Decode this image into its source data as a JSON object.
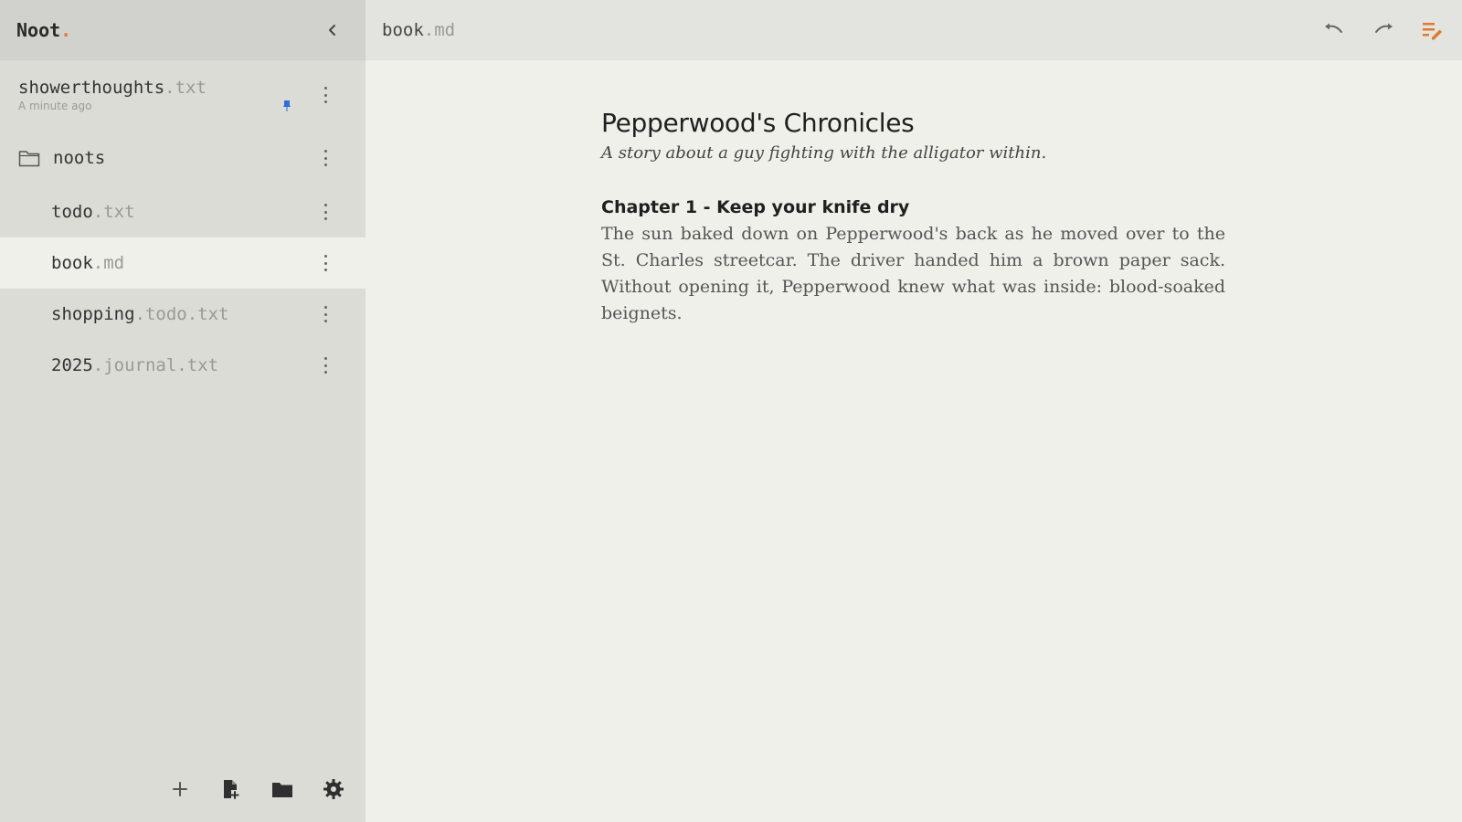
{
  "app": {
    "brand": "Noot",
    "brand_dot": "."
  },
  "sidebar": {
    "pinned": {
      "name": "showerthoughts",
      "ext": ".txt",
      "subtitle": "A minute ago"
    },
    "folder": {
      "name": "noots"
    },
    "files": [
      {
        "name": "todo",
        "ext": ".txt",
        "selected": false
      },
      {
        "name": "book",
        "ext": ".md",
        "selected": true
      },
      {
        "name": "shopping",
        "ext": ".todo.txt",
        "selected": false
      },
      {
        "name": "2025",
        "ext": ".journal.txt",
        "selected": false
      }
    ],
    "footer_icons": [
      "plus-icon",
      "new-file-icon",
      "folder-icon",
      "gear-icon"
    ]
  },
  "topbar": {
    "title_name": "book",
    "title_ext": ".md",
    "icons": [
      "undo-icon",
      "redo-icon",
      "edit-mode-icon"
    ]
  },
  "document": {
    "title": "Pepperwood's Chronicles",
    "tagline": "A story about a guy fighting with the alligator within.",
    "chapter_heading": "Chapter 1 - Keep your knife dry",
    "paragraph": "The sun baked down on Pepperwood's back as he moved over to the St. Charles streetcar. The driver handed him a brown paper sack. Without opening it, Pepperwood knew what was inside: blood-soaked beignets."
  },
  "colors": {
    "accent": "#e07a2e",
    "pin": "#2f6fd6",
    "sidebar_bg": "#dcdcd7",
    "editor_bg": "#f0f0eb"
  }
}
